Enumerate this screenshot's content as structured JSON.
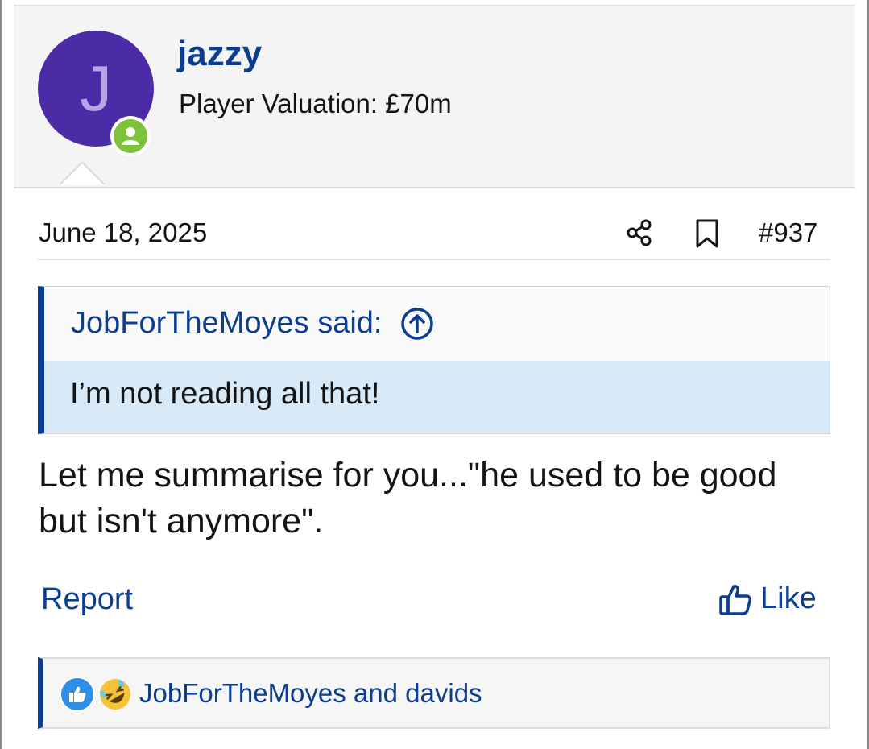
{
  "user": {
    "avatar_letter": "J",
    "name": "jazzy",
    "title": "Player Valuation: £70m",
    "status": "online"
  },
  "post": {
    "date": "June 18, 2025",
    "number": "#937",
    "quote": {
      "author_line": "JobForTheMoyes said:",
      "text": "I’m not reading all that!"
    },
    "message": "Let me summarise for you...\"he used to be good but isn't anymore\"."
  },
  "actions": {
    "report_label": "Report",
    "like_label": "Like"
  },
  "reactions": {
    "icons": [
      "thumbs-up-icon",
      "rofl-emoji-icon"
    ],
    "text": "JobForTheMoyes and davids"
  },
  "colors": {
    "accent": "#0b3d91",
    "avatar_bg": "#4b2ba6",
    "online": "#7cc33b",
    "quote_bg": "#d8eaf8"
  }
}
